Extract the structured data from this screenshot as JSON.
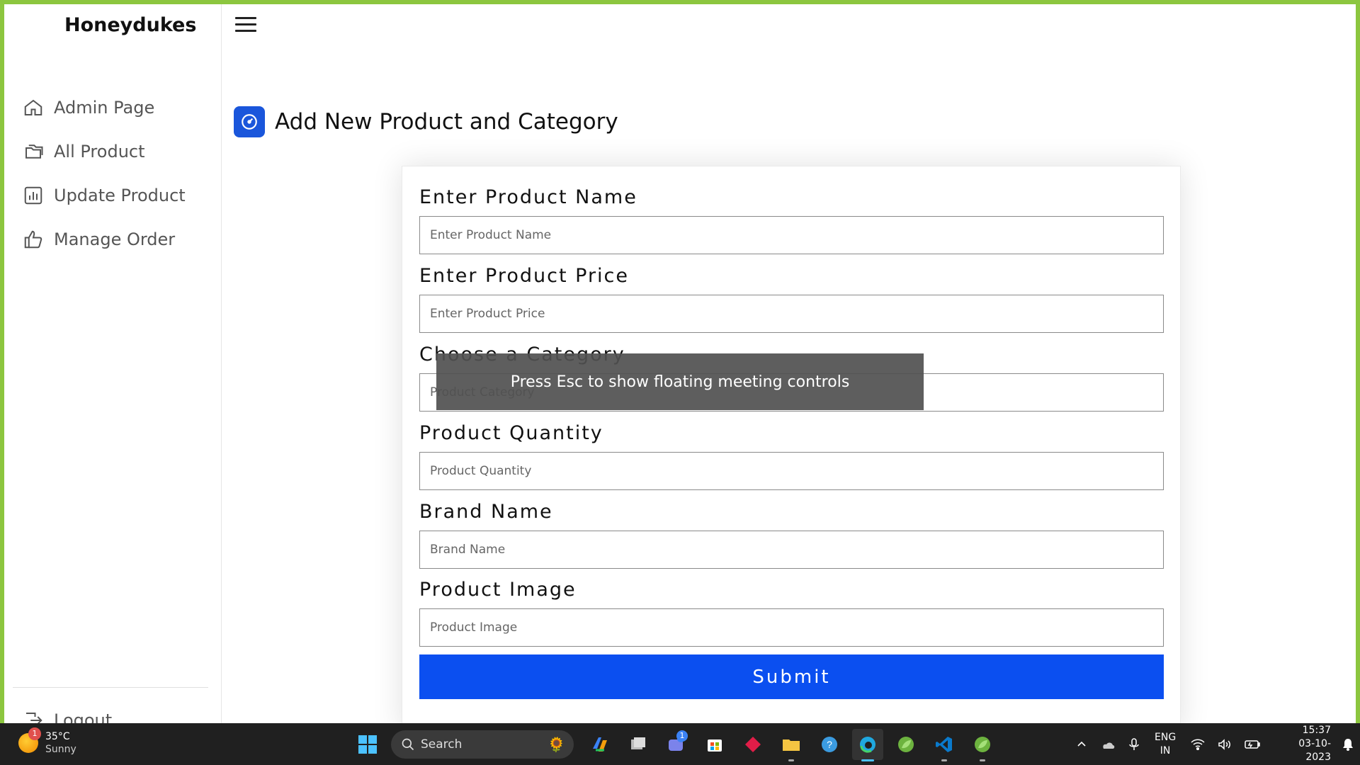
{
  "sidebar": {
    "brand": "Honeydukes",
    "items": [
      {
        "label": "Admin Page",
        "icon": "home-icon"
      },
      {
        "label": "All Product",
        "icon": "folder-icon"
      },
      {
        "label": "Update Product",
        "icon": "bar-chart-icon"
      },
      {
        "label": "Manage Order",
        "icon": "thumbs-up-icon"
      }
    ],
    "logout": "Logout"
  },
  "page": {
    "title": "Add New Product and Category",
    "heading_icon": "speedometer-icon"
  },
  "form": {
    "fields": [
      {
        "label": "Enter Product Name",
        "placeholder": "Enter Product Name"
      },
      {
        "label": "Enter Product Price",
        "placeholder": "Enter Product Price"
      },
      {
        "label": "Choose a Category",
        "placeholder": "Product Category"
      },
      {
        "label": "Product Quantity",
        "placeholder": "Product Quantity"
      },
      {
        "label": "Brand Name",
        "placeholder": "Brand Name"
      },
      {
        "label": "Product Image",
        "placeholder": "Product Image"
      }
    ],
    "submit_label": "Submit"
  },
  "toast": {
    "message": "Press Esc to show floating meeting controls"
  },
  "taskbar": {
    "weather": {
      "temp": "35°C",
      "condition": "Sunny",
      "badge": "1"
    },
    "search_label": "Search",
    "apps": [
      "copilot-icon",
      "task-view-icon",
      "teams-icon",
      "store-icon",
      "app-red-icon",
      "file-explorer-icon",
      "help-icon",
      "edge-icon",
      "spring-icon",
      "vscode-icon",
      "spring-icon"
    ],
    "teams_badge": "1",
    "lang": {
      "line1": "ENG",
      "line2": "IN"
    },
    "time": "15:37",
    "date": "03-10-2023"
  },
  "colors": {
    "primary": "#0b4ff0",
    "frame": "#8cc63f",
    "taskbar": "#202020"
  }
}
